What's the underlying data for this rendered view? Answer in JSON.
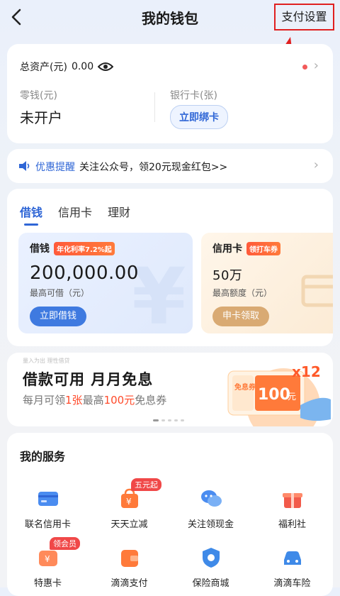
{
  "header": {
    "title": "我的钱包",
    "pay_settings": "支付设置"
  },
  "assets": {
    "total_label": "总资产(元)",
    "total_value": "0.00",
    "change_label": "零钱(元)",
    "change_value": "未开户",
    "bank_label": "银行卡(张)",
    "bind_button": "立即绑卡"
  },
  "notice": {
    "highlight": "优惠提醒",
    "text": "关注公众号，领20元现金红包>>"
  },
  "finance": {
    "tabs": [
      "借钱",
      "信用卡",
      "理财"
    ],
    "loan": {
      "name": "借钱",
      "tag": "年化利率7.2%起",
      "amount": "200,000.00",
      "sub": "最高可借（元）",
      "button": "立即借钱"
    },
    "credit": {
      "name": "信用卡",
      "tag": "领打车券",
      "amount": "50万",
      "sub": "最高额度（元）",
      "button": "申卡领取"
    }
  },
  "banner": {
    "small": "量入为出 理性借贷",
    "title": "借款可用 月月免息",
    "sub_a": "每月可领",
    "sub_b": "1张",
    "sub_c": "最高",
    "sub_d": "100元",
    "sub_e": "免息券",
    "art_tag": "免息券",
    "art_value": "100",
    "art_unit": "元",
    "art_mult": "x12"
  },
  "services": {
    "title": "我的服务",
    "items": [
      {
        "label": "联名信用卡",
        "badge": ""
      },
      {
        "label": "天天立减",
        "badge": "五元起"
      },
      {
        "label": "关注领现金",
        "badge": ""
      },
      {
        "label": "福利社",
        "badge": ""
      },
      {
        "label": "特惠卡",
        "badge": "领会员"
      },
      {
        "label": "滴滴支付",
        "badge": ""
      },
      {
        "label": "保险商城",
        "badge": ""
      },
      {
        "label": "滴滴车险",
        "badge": ""
      }
    ]
  },
  "colors": {
    "accent": "#2f66d6",
    "highlight_box": "#e02020",
    "orange": "#ff6a2a"
  }
}
